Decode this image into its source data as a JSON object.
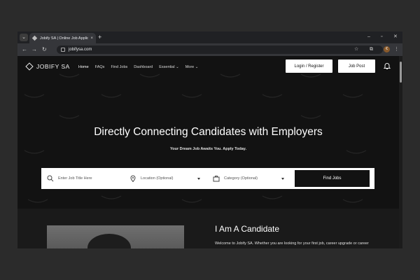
{
  "browser": {
    "tab_title": "Jobify SA | Online Job Applicati...",
    "tab_close": "×",
    "new_tab": "+",
    "tab_menu": "⌄",
    "win_minimize": "–",
    "win_restore": "▫",
    "win_close": "✕",
    "back": "←",
    "forward": "→",
    "reload": "↻",
    "url": "jobifysa.com",
    "star": "☆",
    "extensions": "⧉",
    "profile_initial": "€",
    "more": "⋮"
  },
  "site": {
    "logo_text": "JOBIFY SA",
    "nav": [
      "Home",
      "FAQs",
      "Find Jobs",
      "Dashboard",
      "Essential",
      "More"
    ],
    "login_label": "Login / Register",
    "job_post_label": "Job Post"
  },
  "hero": {
    "headline": "Directly Connecting Candidates with Employers",
    "subline": "Your Dream Job Awaits You. Apply Today."
  },
  "search": {
    "job_placeholder": "Enter Job Title Here",
    "location_placeholder": "Location (Optional)",
    "category_placeholder": "Category (Optional)",
    "find_label": "Find Jobs"
  },
  "candidate": {
    "title": "I Am A Candidate",
    "text": "Welcome to Jobify SA. Whether you are looking for your first job, career upgrade or career"
  },
  "colors": {
    "background": "#121212",
    "accent": "#ffffff"
  }
}
